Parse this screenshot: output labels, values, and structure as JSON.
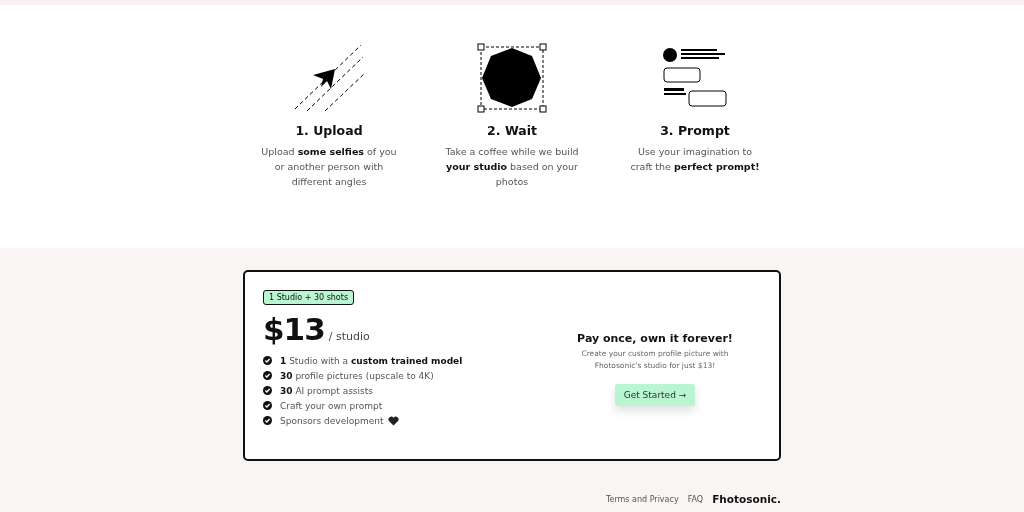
{
  "steps": [
    {
      "kind": "upload",
      "title": "1. Upload",
      "text": "Upload **some selfies** of you or another person with different angles"
    },
    {
      "kind": "wait",
      "title": "2. Wait",
      "text": "Take a coffee while we build **your studio** based on your photos"
    },
    {
      "kind": "prompt",
      "title": "3. Prompt",
      "text": "Use your imagination to craft the **perfect prompt!**"
    }
  ],
  "pricing": {
    "badge": "1 Studio + 30 shots",
    "price": "$13",
    "unit": "/ studio",
    "features": [
      {
        "text": "**1** Studio with a **custom trained model**"
      },
      {
        "text": "**30** profile pictures (upscale to 4K)"
      },
      {
        "text": "**30** AI prompt assists"
      },
      {
        "text": "Craft your own prompt"
      },
      {
        "text": "Sponsors development",
        "heart": true
      }
    ],
    "headline": "Pay once, own it forever!",
    "description": "Create your custom profile picture with Fhotosonic's studio for just $13!",
    "button": "Get Started →"
  },
  "footer": {
    "links": [
      "Terms and Privacy",
      "FAQ"
    ],
    "brand": "Fhotosonic."
  }
}
